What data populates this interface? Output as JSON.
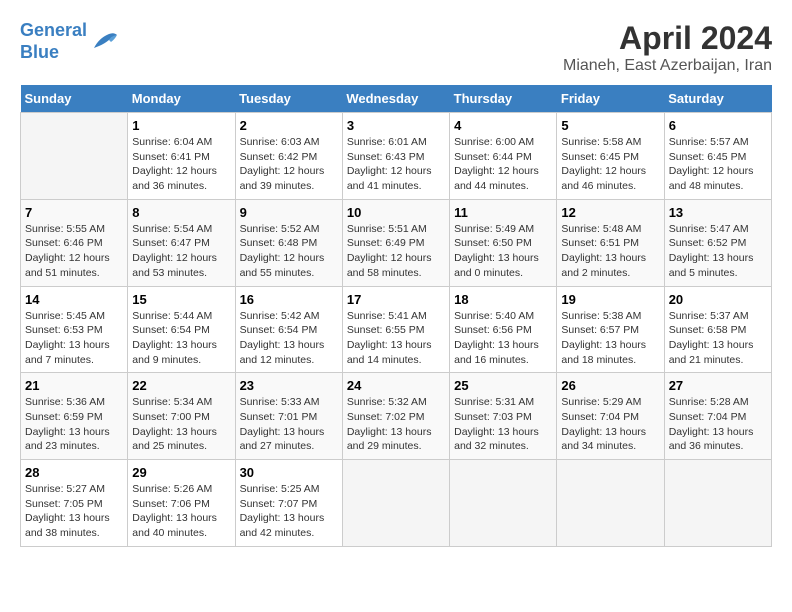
{
  "header": {
    "logo_line1": "General",
    "logo_line2": "Blue",
    "title": "April 2024",
    "subtitle": "Mianeh, East Azerbaijan, Iran"
  },
  "calendar": {
    "days_of_week": [
      "Sunday",
      "Monday",
      "Tuesday",
      "Wednesday",
      "Thursday",
      "Friday",
      "Saturday"
    ],
    "weeks": [
      [
        {
          "day": "",
          "info": ""
        },
        {
          "day": "1",
          "info": "Sunrise: 6:04 AM\nSunset: 6:41 PM\nDaylight: 12 hours\nand 36 minutes."
        },
        {
          "day": "2",
          "info": "Sunrise: 6:03 AM\nSunset: 6:42 PM\nDaylight: 12 hours\nand 39 minutes."
        },
        {
          "day": "3",
          "info": "Sunrise: 6:01 AM\nSunset: 6:43 PM\nDaylight: 12 hours\nand 41 minutes."
        },
        {
          "day": "4",
          "info": "Sunrise: 6:00 AM\nSunset: 6:44 PM\nDaylight: 12 hours\nand 44 minutes."
        },
        {
          "day": "5",
          "info": "Sunrise: 5:58 AM\nSunset: 6:45 PM\nDaylight: 12 hours\nand 46 minutes."
        },
        {
          "day": "6",
          "info": "Sunrise: 5:57 AM\nSunset: 6:45 PM\nDaylight: 12 hours\nand 48 minutes."
        }
      ],
      [
        {
          "day": "7",
          "info": "Sunrise: 5:55 AM\nSunset: 6:46 PM\nDaylight: 12 hours\nand 51 minutes."
        },
        {
          "day": "8",
          "info": "Sunrise: 5:54 AM\nSunset: 6:47 PM\nDaylight: 12 hours\nand 53 minutes."
        },
        {
          "day": "9",
          "info": "Sunrise: 5:52 AM\nSunset: 6:48 PM\nDaylight: 12 hours\nand 55 minutes."
        },
        {
          "day": "10",
          "info": "Sunrise: 5:51 AM\nSunset: 6:49 PM\nDaylight: 12 hours\nand 58 minutes."
        },
        {
          "day": "11",
          "info": "Sunrise: 5:49 AM\nSunset: 6:50 PM\nDaylight: 13 hours\nand 0 minutes."
        },
        {
          "day": "12",
          "info": "Sunrise: 5:48 AM\nSunset: 6:51 PM\nDaylight: 13 hours\nand 2 minutes."
        },
        {
          "day": "13",
          "info": "Sunrise: 5:47 AM\nSunset: 6:52 PM\nDaylight: 13 hours\nand 5 minutes."
        }
      ],
      [
        {
          "day": "14",
          "info": "Sunrise: 5:45 AM\nSunset: 6:53 PM\nDaylight: 13 hours\nand 7 minutes."
        },
        {
          "day": "15",
          "info": "Sunrise: 5:44 AM\nSunset: 6:54 PM\nDaylight: 13 hours\nand 9 minutes."
        },
        {
          "day": "16",
          "info": "Sunrise: 5:42 AM\nSunset: 6:54 PM\nDaylight: 13 hours\nand 12 minutes."
        },
        {
          "day": "17",
          "info": "Sunrise: 5:41 AM\nSunset: 6:55 PM\nDaylight: 13 hours\nand 14 minutes."
        },
        {
          "day": "18",
          "info": "Sunrise: 5:40 AM\nSunset: 6:56 PM\nDaylight: 13 hours\nand 16 minutes."
        },
        {
          "day": "19",
          "info": "Sunrise: 5:38 AM\nSunset: 6:57 PM\nDaylight: 13 hours\nand 18 minutes."
        },
        {
          "day": "20",
          "info": "Sunrise: 5:37 AM\nSunset: 6:58 PM\nDaylight: 13 hours\nand 21 minutes."
        }
      ],
      [
        {
          "day": "21",
          "info": "Sunrise: 5:36 AM\nSunset: 6:59 PM\nDaylight: 13 hours\nand 23 minutes."
        },
        {
          "day": "22",
          "info": "Sunrise: 5:34 AM\nSunset: 7:00 PM\nDaylight: 13 hours\nand 25 minutes."
        },
        {
          "day": "23",
          "info": "Sunrise: 5:33 AM\nSunset: 7:01 PM\nDaylight: 13 hours\nand 27 minutes."
        },
        {
          "day": "24",
          "info": "Sunrise: 5:32 AM\nSunset: 7:02 PM\nDaylight: 13 hours\nand 29 minutes."
        },
        {
          "day": "25",
          "info": "Sunrise: 5:31 AM\nSunset: 7:03 PM\nDaylight: 13 hours\nand 32 minutes."
        },
        {
          "day": "26",
          "info": "Sunrise: 5:29 AM\nSunset: 7:04 PM\nDaylight: 13 hours\nand 34 minutes."
        },
        {
          "day": "27",
          "info": "Sunrise: 5:28 AM\nSunset: 7:04 PM\nDaylight: 13 hours\nand 36 minutes."
        }
      ],
      [
        {
          "day": "28",
          "info": "Sunrise: 5:27 AM\nSunset: 7:05 PM\nDaylight: 13 hours\nand 38 minutes."
        },
        {
          "day": "29",
          "info": "Sunrise: 5:26 AM\nSunset: 7:06 PM\nDaylight: 13 hours\nand 40 minutes."
        },
        {
          "day": "30",
          "info": "Sunrise: 5:25 AM\nSunset: 7:07 PM\nDaylight: 13 hours\nand 42 minutes."
        },
        {
          "day": "",
          "info": ""
        },
        {
          "day": "",
          "info": ""
        },
        {
          "day": "",
          "info": ""
        },
        {
          "day": "",
          "info": ""
        }
      ]
    ]
  }
}
